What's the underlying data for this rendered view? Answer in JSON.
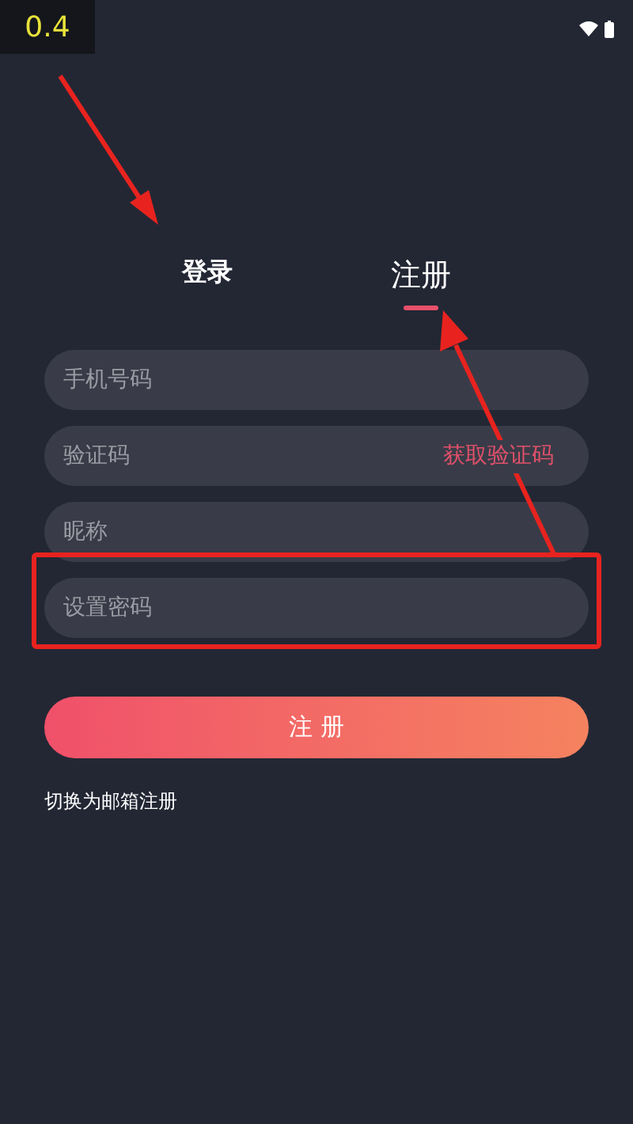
{
  "overlay_badge": "0.4",
  "tabs": [
    {
      "label": "登录",
      "selected": false
    },
    {
      "label": "注册",
      "selected": true
    }
  ],
  "fields": [
    {
      "placeholder": "手机号码"
    },
    {
      "placeholder": "验证码",
      "action": "获取验证码"
    },
    {
      "placeholder": "昵称"
    },
    {
      "placeholder": "设置密码",
      "highlighted": true
    }
  ],
  "submit_button": "注 册",
  "switch_link": "切换为邮箱注册"
}
